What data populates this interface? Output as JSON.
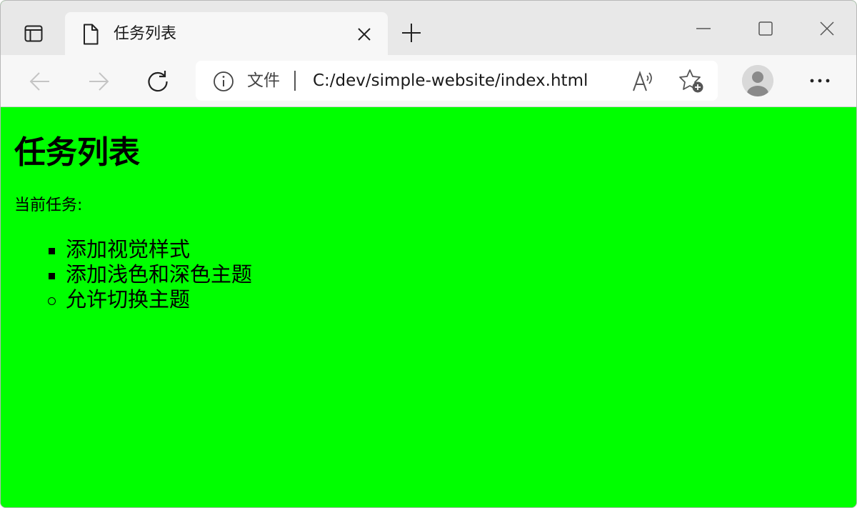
{
  "browser": {
    "tab": {
      "title": "任务列表"
    },
    "address_bar": {
      "scheme_label": "文件",
      "url": "C:/dev/simple-website/index.html"
    },
    "icons": {
      "tab_actions": "tab-actions-icon",
      "page": "page-icon",
      "close_tab": "close-icon",
      "new_tab": "plus-icon",
      "minimize": "minimize-icon",
      "maximize": "maximize-icon",
      "close_window": "close-icon",
      "back": "arrow-left-icon",
      "forward": "arrow-right-icon",
      "refresh": "refresh-icon",
      "site_info": "info-icon",
      "read_aloud": "read-aloud-icon",
      "favorites": "add-favorite-icon",
      "profile": "avatar-icon",
      "more": "more-icon"
    },
    "colors": {
      "tabbar_bg": "#e8e8e8",
      "toolbar_bg": "#f7f7f7",
      "page_bg": "#00ff00"
    }
  },
  "page": {
    "heading": "任务列表",
    "current_label": "当前任务:",
    "tasks": [
      {
        "text": "添加视觉样式",
        "bullet": "square"
      },
      {
        "text": "添加浅色和深色主题",
        "bullet": "square"
      },
      {
        "text": "允许切换主题",
        "bullet": "circle"
      }
    ]
  }
}
